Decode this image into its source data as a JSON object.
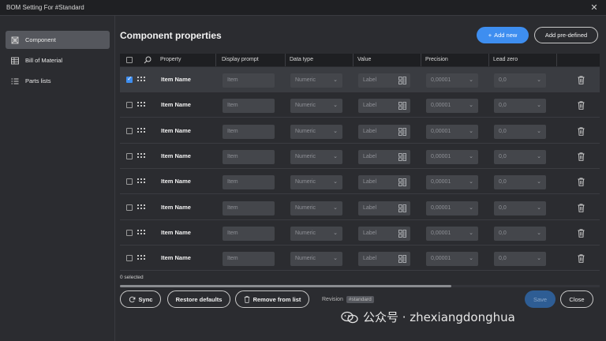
{
  "window": {
    "title": "BOM Setting For #Standard"
  },
  "sidebar": {
    "items": [
      {
        "label": "Component",
        "icon": "component-icon",
        "active": true
      },
      {
        "label": "Bill of Material",
        "icon": "table-icon",
        "active": false
      },
      {
        "label": "Parts lists",
        "icon": "list-icon",
        "active": false
      }
    ]
  },
  "main": {
    "title": "Component properties",
    "add_new_label": "Add new",
    "add_predefined_label": "Add pre-defined"
  },
  "table": {
    "columns": [
      "Property",
      "Display prompt",
      "Data type",
      "Value",
      "Precision",
      "Lead zero"
    ],
    "rows": [
      {
        "checked": true,
        "property": "Item Name",
        "display_prompt": "Item",
        "data_type": "Numeric",
        "value": "Label",
        "precision": "0,00001",
        "lead_zero": "0,0"
      },
      {
        "checked": false,
        "property": "Item Name",
        "display_prompt": "Item",
        "data_type": "Numeric",
        "value": "Label",
        "precision": "0,00001",
        "lead_zero": "0,0"
      },
      {
        "checked": false,
        "property": "Item Name",
        "display_prompt": "Item",
        "data_type": "Numeric",
        "value": "Label",
        "precision": "0,00001",
        "lead_zero": "0,0"
      },
      {
        "checked": false,
        "property": "Item Name",
        "display_prompt": "Item",
        "data_type": "Numeric",
        "value": "Label",
        "precision": "0,00001",
        "lead_zero": "0,0"
      },
      {
        "checked": false,
        "property": "Item Name",
        "display_prompt": "Item",
        "data_type": "Numeric",
        "value": "Label",
        "precision": "0,00001",
        "lead_zero": "0,0"
      },
      {
        "checked": false,
        "property": "Item Name",
        "display_prompt": "Item",
        "data_type": "Numeric",
        "value": "Label",
        "precision": "0,00001",
        "lead_zero": "0,0"
      },
      {
        "checked": false,
        "property": "Item Name",
        "display_prompt": "Item",
        "data_type": "Numeric",
        "value": "Label",
        "precision": "0,00001",
        "lead_zero": "0,0"
      },
      {
        "checked": false,
        "property": "Item Name",
        "display_prompt": "Item",
        "data_type": "Numeric",
        "value": "Label",
        "precision": "0,00001",
        "lead_zero": "0,0"
      }
    ]
  },
  "footer": {
    "selected_text": "0 selected",
    "sync_label": "Sync",
    "restore_label": "Restore defaults",
    "remove_label": "Remove from list",
    "revision_label": "Revision",
    "revision_tag": "#standard",
    "save_label": "Save",
    "close_label": "Close"
  },
  "watermark": {
    "text": "公众号 · zhexiangdonghua"
  },
  "colors": {
    "accent": "#3e8ef0",
    "background": "#2b2c30",
    "selected_row": "#3a3c41"
  }
}
